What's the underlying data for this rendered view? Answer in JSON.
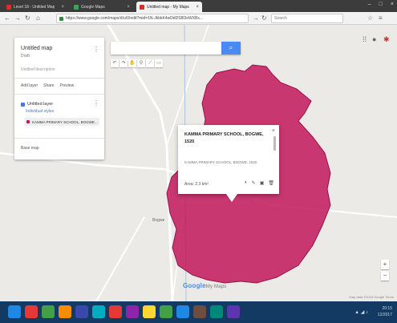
{
  "browser": {
    "tabs": [
      {
        "label": "Level 18 - Untitled Map",
        "color": "#d93025",
        "active": false
      },
      {
        "label": "Google Maps",
        "color": "#34a853",
        "active": false
      },
      {
        "label": "Untitled map - My Maps",
        "color": "#d93025",
        "active": true
      }
    ],
    "url": "https://www.google.com/maps/d/u/0/edit?mid=1N-JkbkK4wDdDS8l3oWXBs...",
    "search_placeholder": "Search"
  },
  "map_panel": {
    "title": "Untitled map",
    "subtitle": "Draft",
    "description": "Untitled description",
    "actions": [
      "Add layer",
      "Share",
      "Preview"
    ],
    "layer": {
      "name": "Untitled layer",
      "style_label": "Individual styles",
      "feature_label": "KAMMA PRIMARY SCHOOL, BOGWE..."
    },
    "base_layer": "Base map"
  },
  "map": {
    "search_placeholder": "",
    "tools": [
      "hand-icon",
      "marker-icon",
      "line-icon",
      "ruler-icon",
      "direction-icon"
    ],
    "place_label": "Bogwe",
    "logo": "Google",
    "logo_suffix": "My Maps",
    "footer": "Map data ©2018 Google   Terms",
    "polygon_color": "#c2185b"
  },
  "info_window": {
    "title": "KAMMA PRIMARY SCHOOL, BOGWE, 1520",
    "description": "KAMMA PRIMARY SCHOOL, BOGWE, 1520",
    "footer": "Area: 2.3 km²"
  },
  "taskbar": {
    "time": "20:15",
    "date": "12/2017",
    "apps": [
      "#1e88e5",
      "#e53935",
      "#43a047",
      "#fb8c00",
      "#3949ab",
      "#00acc1",
      "#e53935",
      "#8e24aa",
      "#fdd835",
      "#43a047",
      "#1e88e5",
      "#6d4c41",
      "#00897b",
      "#5e35b1"
    ]
  }
}
